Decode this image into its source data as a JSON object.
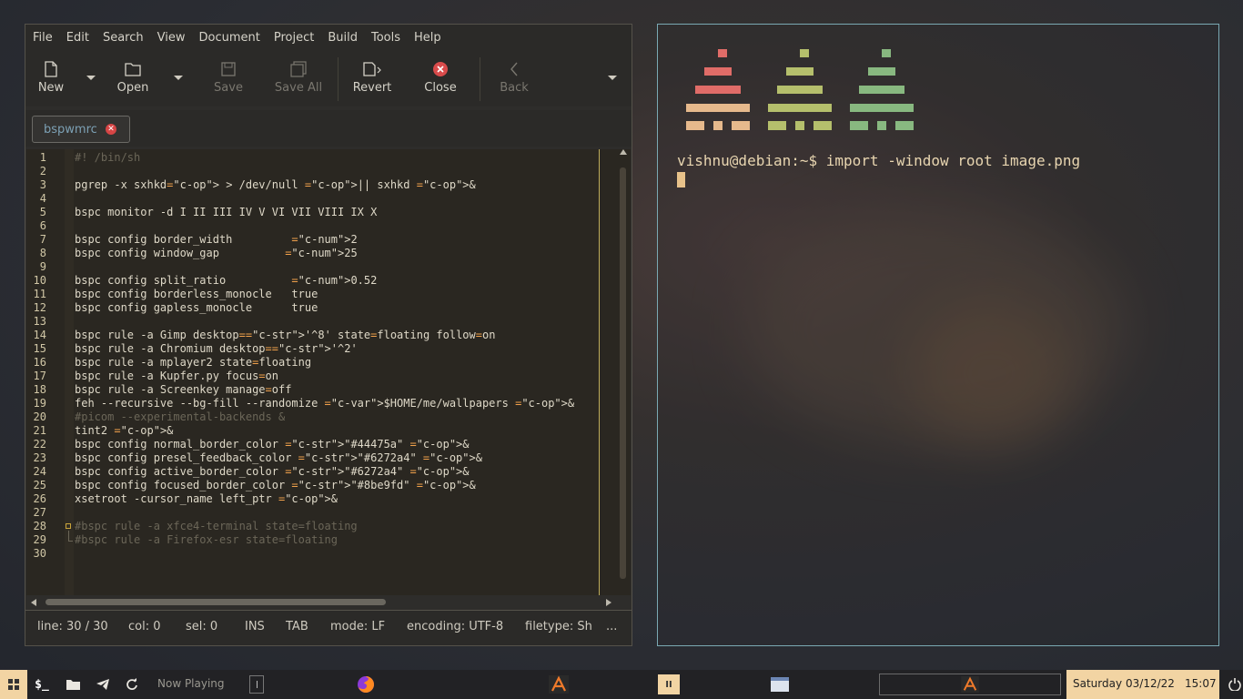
{
  "geany": {
    "menu": [
      "File",
      "Edit",
      "Search",
      "View",
      "Document",
      "Project",
      "Build",
      "Tools",
      "Help"
    ],
    "toolbar": {
      "new": "New",
      "open": "Open",
      "save": "Save",
      "save_all": "Save All",
      "revert": "Revert",
      "close": "Close",
      "back": "Back"
    },
    "tab": {
      "label": "bspwmrc"
    },
    "line_numbers": [
      "1",
      "2",
      "3",
      "4",
      "5",
      "6",
      "7",
      "8",
      "9",
      "10",
      "11",
      "12",
      "13",
      "14",
      "15",
      "16",
      "17",
      "18",
      "19",
      "20",
      "21",
      "22",
      "23",
      "24",
      "25",
      "26",
      "27",
      "28",
      "29",
      "30"
    ],
    "code_lines": [
      "#! /bin/sh",
      "",
      "pgrep -x sxhkd > /dev/null || sxhkd &",
      "",
      "bspc monitor -d I II III IV V VI VII VIII IX X",
      "",
      "bspc config border_width         2",
      "bspc config window_gap          25",
      "",
      "bspc config split_ratio          0.52",
      "bspc config borderless_monocle   true",
      "bspc config gapless_monocle      true",
      "",
      "bspc rule -a Gimp desktop='^8' state=floating follow=on",
      "bspc rule -a Chromium desktop='^2'",
      "bspc rule -a mplayer2 state=floating",
      "bspc rule -a Kupfer.py focus=on",
      "bspc rule -a Screenkey manage=off",
      "feh --recursive --bg-fill --randomize $HOME/me/wallpapers &",
      "#picom --experimental-backends &",
      "tint2 &",
      "bspc config normal_border_color \"#44475a\" &",
      "bspc config presel_feedback_color \"#6272a4\" &",
      "bspc config active_border_color \"#6272a4\" &",
      "bspc config focused_border_color \"#8be9fd\" &",
      "xsetroot -cursor_name left_ptr &",
      "",
      "#bspc rule -a xfce4-terminal state=floating",
      "#bspc rule -a Firefox-esr state=floating",
      ""
    ],
    "status": {
      "line": "line: 30 / 30",
      "col": "col: 0",
      "sel": "sel: 0",
      "ins": "INS",
      "tab": "TAB",
      "mode": "mode: LF",
      "encoding": "encoding: UTF-8",
      "filetype": "filetype: Sh",
      "more": "..."
    }
  },
  "terminal": {
    "prompt": "vishnu@debian:~$ import -window root image.png",
    "logo_colors": [
      "#e06c68",
      "#b5bf6c",
      "#88b880",
      "#e6b98c"
    ]
  },
  "taskbar": {
    "now_playing": "Now Playing",
    "play_pause": "II",
    "day": "Saturday",
    "date": "03/12/22",
    "time": "15:07",
    "accent": "#f2d4a3"
  }
}
